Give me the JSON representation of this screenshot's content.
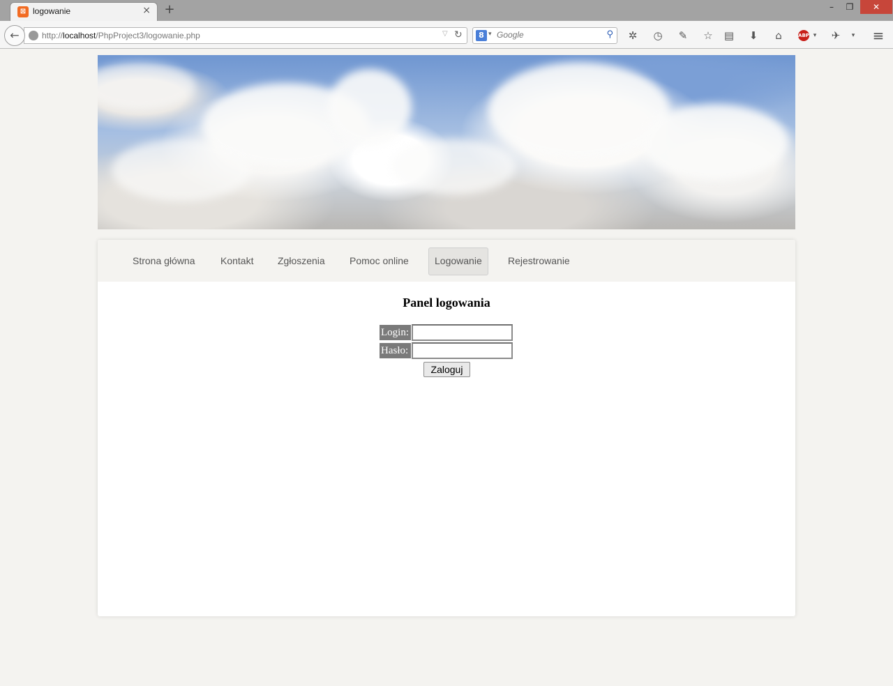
{
  "browser": {
    "tab_title": "logowanie",
    "tab_close": "×",
    "new_tab": "+",
    "window": {
      "minimize": "–",
      "maximize": "❐",
      "close": "✕"
    },
    "url": {
      "scheme": "http://",
      "host": "localhost",
      "path": "/PhpProject3/logowanie.php"
    },
    "search": {
      "placeholder": "Google",
      "engine_glyph": "8"
    },
    "icons": {
      "back": "←",
      "reload": "↻",
      "url_dropdown": "▽",
      "search_go": "⚲",
      "settings": "✲",
      "history": "◷",
      "tools": "✎",
      "bookmark": "☆",
      "reader": "▤",
      "download": "⬇",
      "home": "⌂",
      "adblock": "ABP",
      "extension": "✈",
      "dropdown": "▾",
      "menu": "≡"
    }
  },
  "page": {
    "menu": [
      {
        "label": "Strona główna"
      },
      {
        "label": "Kontakt"
      },
      {
        "label": "Zgłoszenia"
      },
      {
        "label": "Pomoc online"
      },
      {
        "label": "Logowanie",
        "active": true
      },
      {
        "label": "Rejestrowanie"
      }
    ],
    "panel_title": "Panel logowania",
    "form": {
      "login_label": "Login:",
      "login_value": "",
      "password_label": "Hasło:",
      "password_value": "",
      "submit_label": "Zaloguj"
    }
  }
}
